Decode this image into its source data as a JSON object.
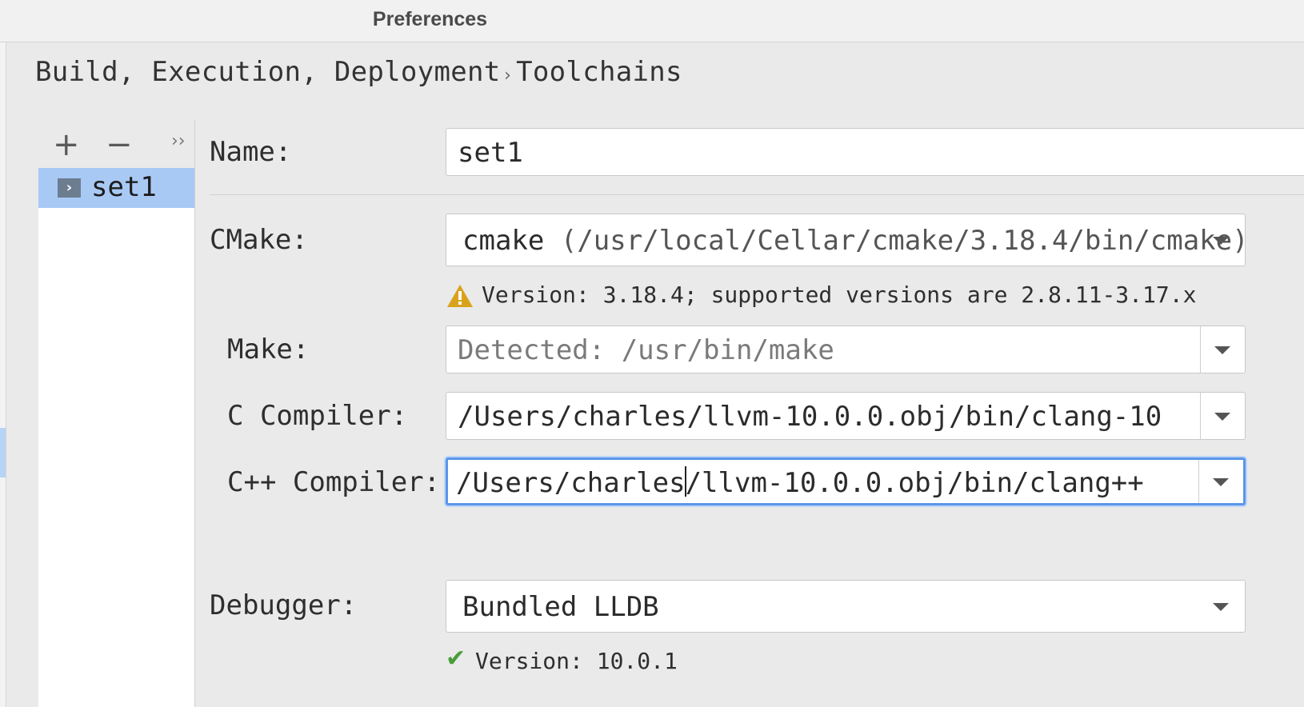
{
  "window": {
    "title": "Preferences"
  },
  "breadcrumb": {
    "parent": "Build, Execution, Deployment",
    "separator": "›",
    "current": "Toolchains"
  },
  "toolbar": {
    "add_label": "+",
    "remove_label": "−",
    "more_label": "››"
  },
  "toolchains": [
    {
      "name": "set1",
      "icon": "toolchain-icon"
    }
  ],
  "form": {
    "name_label": "Name:",
    "name_value": "set1",
    "cmake_label": "CMake:",
    "cmake_value": "cmake",
    "cmake_path": "(/usr/local/Cellar/cmake/3.18.4/bin/cmake)",
    "cmake_warning": "Version: 3.18.4; supported versions are 2.8.11-3.17.x",
    "make_label": "Make:",
    "make_placeholder": "Detected: /usr/bin/make",
    "c_compiler_label": "C Compiler:",
    "c_compiler_value": "/Users/charles/llvm-10.0.0.obj/bin/clang-10",
    "cpp_compiler_label": "C++ Compiler:",
    "cpp_compiler_before_caret": "/Users/charles",
    "cpp_compiler_after_caret": "/llvm-10.0.0.obj/bin/clang++",
    "debugger_label": "Debugger:",
    "debugger_value": "Bundled LLDB",
    "debugger_status": "Version: 10.0.1"
  },
  "colors": {
    "selection": "#a9c9f5",
    "focus": "#5a96e8",
    "warning": "#d9a21b",
    "ok": "#4a9e3a"
  }
}
